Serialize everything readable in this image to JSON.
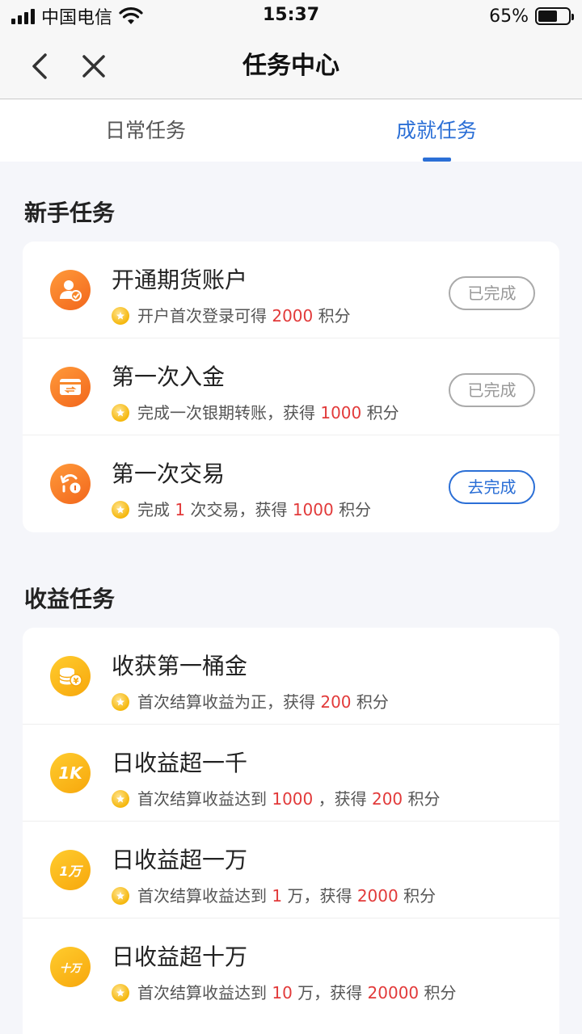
{
  "status_bar": {
    "carrier": "中国电信",
    "time": "15:37",
    "battery": "65%",
    "battery_level": 0.65
  },
  "nav": {
    "title": "任务中心"
  },
  "tabs": [
    {
      "label": "日常任务",
      "active": false
    },
    {
      "label": "成就任务",
      "active": true
    }
  ],
  "colors": {
    "accent": "#2b6fd6",
    "highlight": "#e23a3a",
    "icon_orange": "#f2661c",
    "icon_gold": "#f7a70c"
  },
  "sections": [
    {
      "title": "新手任务",
      "tasks": [
        {
          "title": "开通期货账户",
          "icon": "account-user-icon",
          "sub_pre": "开户首次登录可得",
          "sub_v1": "2000",
          "sub_mid": "积分",
          "sub_v2": "",
          "sub_post": "",
          "button": "已完成",
          "button_state": "done"
        },
        {
          "title": "第一次入金",
          "icon": "transfer-card-icon",
          "sub_pre": "完成一次银期转账，获得",
          "sub_v1": "1000",
          "sub_mid": "积分",
          "sub_v2": "",
          "sub_post": "",
          "button": "已完成",
          "button_state": "done"
        },
        {
          "title": "第一次交易",
          "icon": "trade-icon",
          "sub_pre": "完成",
          "sub_v1": "1",
          "sub_mid": "次交易，获得",
          "sub_v2": "1000",
          "sub_post": "积分",
          "button": "去完成",
          "button_state": "todo"
        }
      ]
    },
    {
      "title": "收益任务",
      "tasks": [
        {
          "title": "收获第一桶金",
          "icon": "coin-stack-icon",
          "icon_text": "",
          "sub_pre": "首次结算收益为正，获得",
          "sub_v1": "200",
          "sub_mid": "积分",
          "sub_v2": "",
          "sub_post": ""
        },
        {
          "title": "日收益超一千",
          "icon": "1k-icon",
          "icon_text": "1K",
          "sub_pre": "首次结算收益达到",
          "sub_v1": "1000",
          "sub_mid": "，获得",
          "sub_v2": "200",
          "sub_post": "积分"
        },
        {
          "title": "日收益超一万",
          "icon": "1wan-icon",
          "icon_text": "1万",
          "sub_pre": "首次结算收益达到",
          "sub_v1": "1",
          "sub_mid": "万，获得",
          "sub_v2": "2000",
          "sub_post": "积分"
        },
        {
          "title": "日收益超十万",
          "icon": "10wan-icon",
          "icon_text": "十万",
          "sub_pre": "首次结算收益达到",
          "sub_v1": "10",
          "sub_mid": "万，获得",
          "sub_v2": "20000",
          "sub_post": "积分"
        }
      ]
    }
  ]
}
